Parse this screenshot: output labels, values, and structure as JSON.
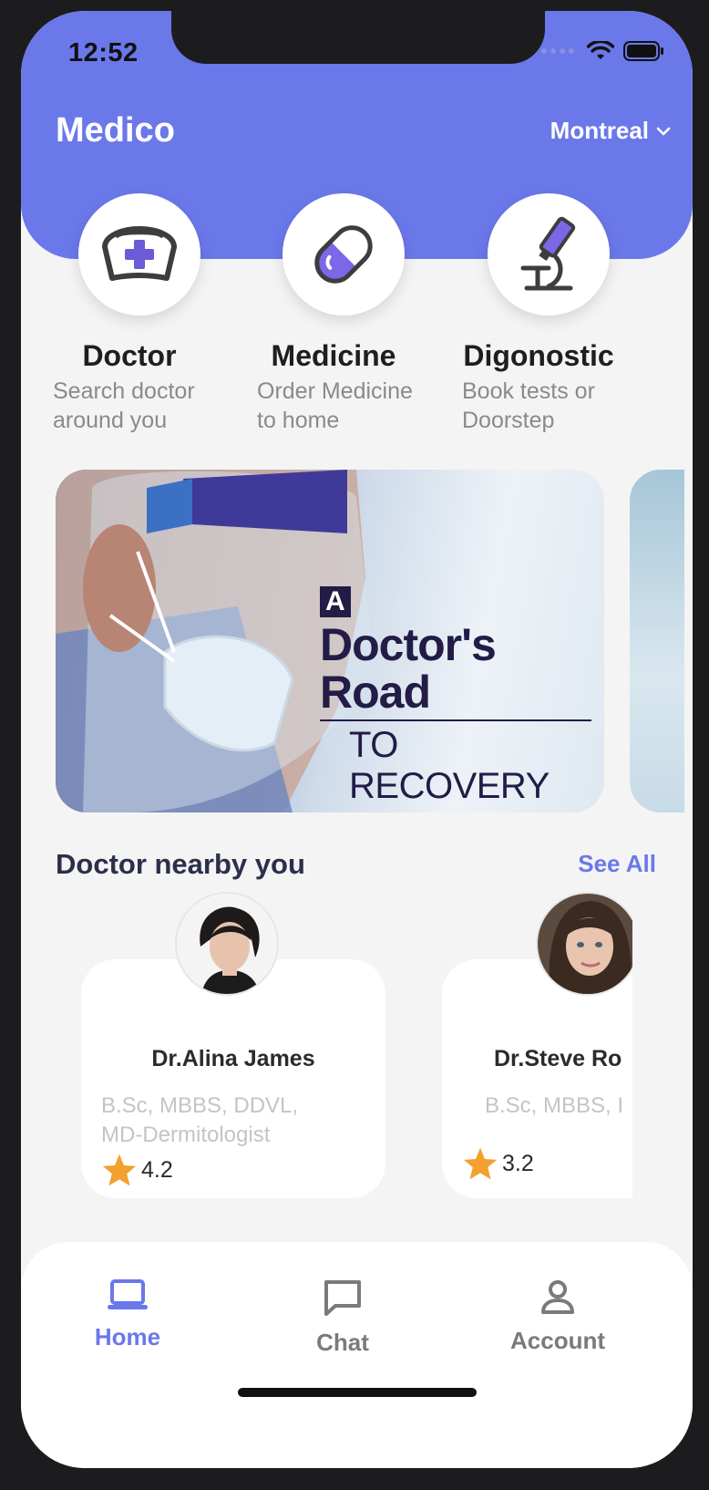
{
  "status_bar": {
    "time": "12:52"
  },
  "header": {
    "app_title": "Medico",
    "city": "Montreal"
  },
  "services": [
    {
      "name": "Doctor",
      "desc_line1": "Search doctor",
      "desc_line2": "around you",
      "icon": "doctor-cap-icon"
    },
    {
      "name": "Medicine",
      "desc_line1": "Order Medicine",
      "desc_line2": "to home",
      "icon": "pill-icon"
    },
    {
      "name": "Digonostic",
      "desc_line1": "Book tests or",
      "desc_line2": "Doorstep",
      "icon": "microscope-icon"
    }
  ],
  "banner": {
    "badge": "A",
    "line1": "Doctor's Road",
    "line2": "TO RECOVERY"
  },
  "nearby": {
    "title": "Doctor nearby you",
    "see_all": "See All",
    "doctors": [
      {
        "name": "Dr.Alina James",
        "deg_line1": "B.Sc, MBBS, DDVL,",
        "deg_line2": "MD-Dermitologist",
        "rating": "4.2"
      },
      {
        "name": "Dr.Steve Ro",
        "deg_line1": "B.Sc, MBBS, I",
        "deg_line2": "",
        "rating": "3.2"
      }
    ]
  },
  "nav": {
    "home": "Home",
    "chat": "Chat",
    "account": "Account"
  },
  "colors": {
    "accent": "#6b78ea",
    "star": "#f2a12e",
    "inactive": "#7a7a7a"
  }
}
